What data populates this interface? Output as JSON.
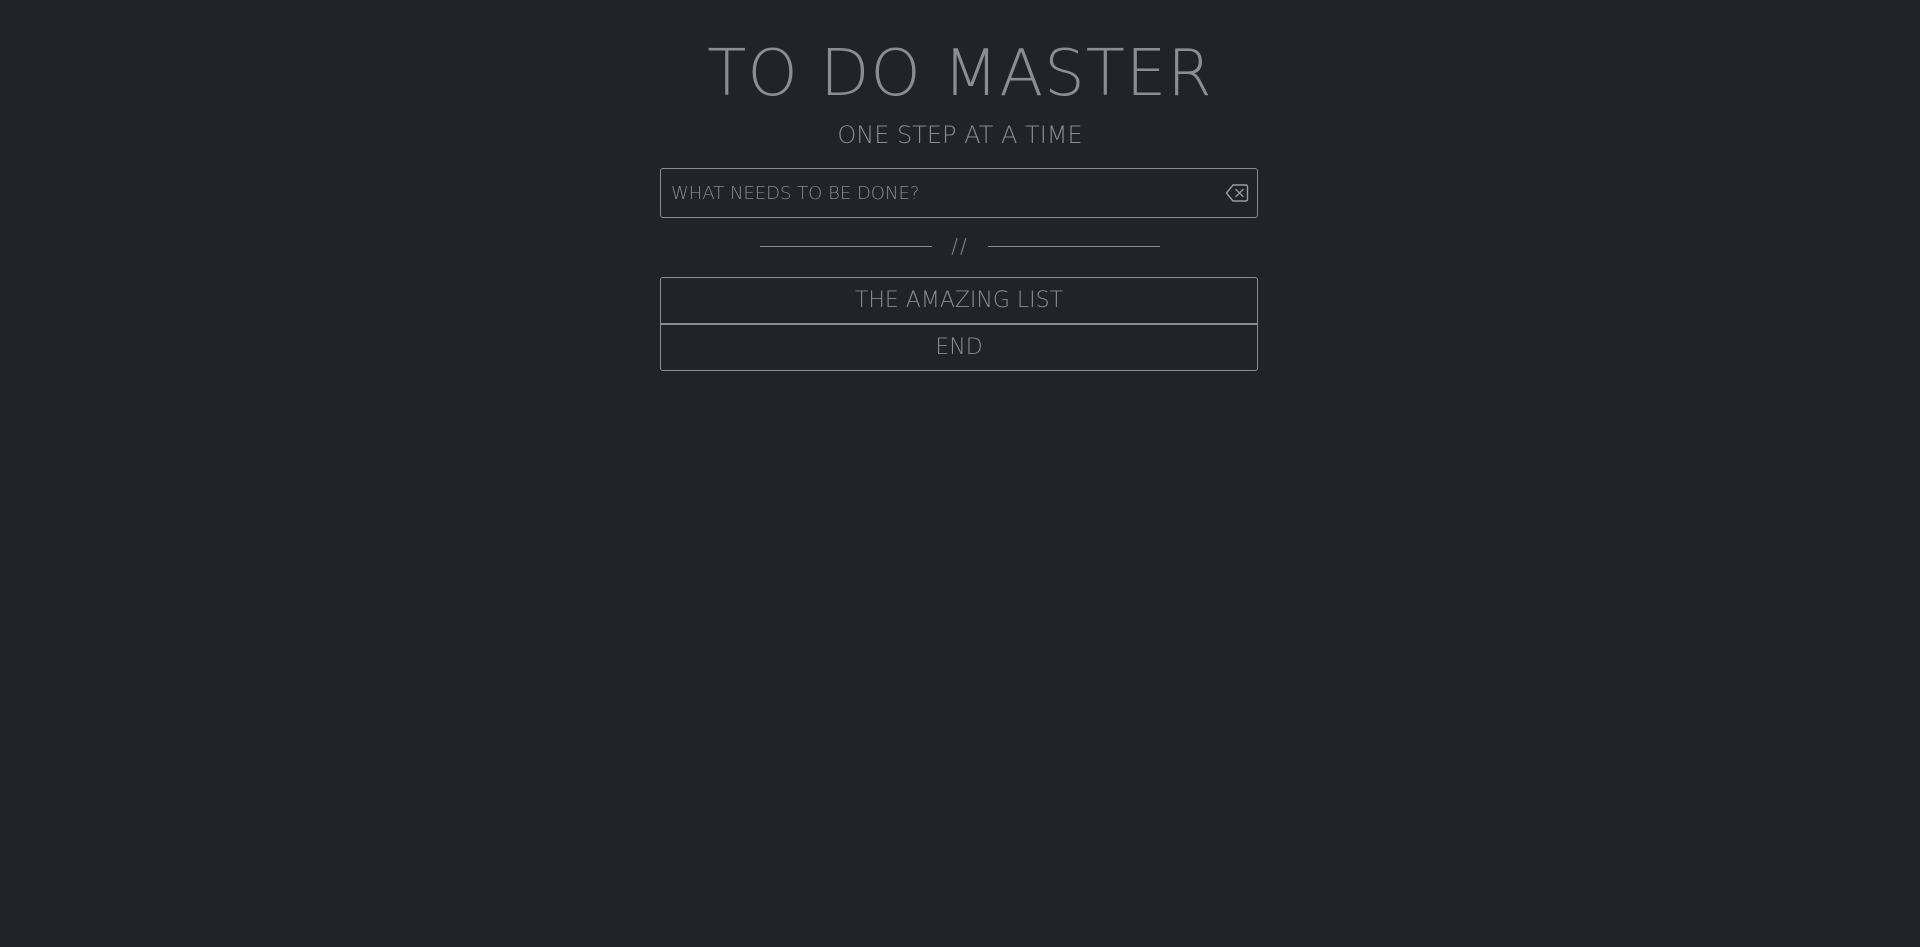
{
  "app": {
    "title": "TO DO MASTER",
    "subtitle": "ONE STEP AT A TIME"
  },
  "input": {
    "placeholder": "WHAT NEEDS TO BE DONE?",
    "value": "",
    "clear_icon": "backspace-clear-icon"
  },
  "divider": {
    "text": "//"
  },
  "list": {
    "items": [
      {
        "label": "THE AMAZING LIST"
      },
      {
        "label": "END"
      }
    ]
  },
  "colors": {
    "background": "#222328",
    "foreground": "#8a8b8f"
  }
}
